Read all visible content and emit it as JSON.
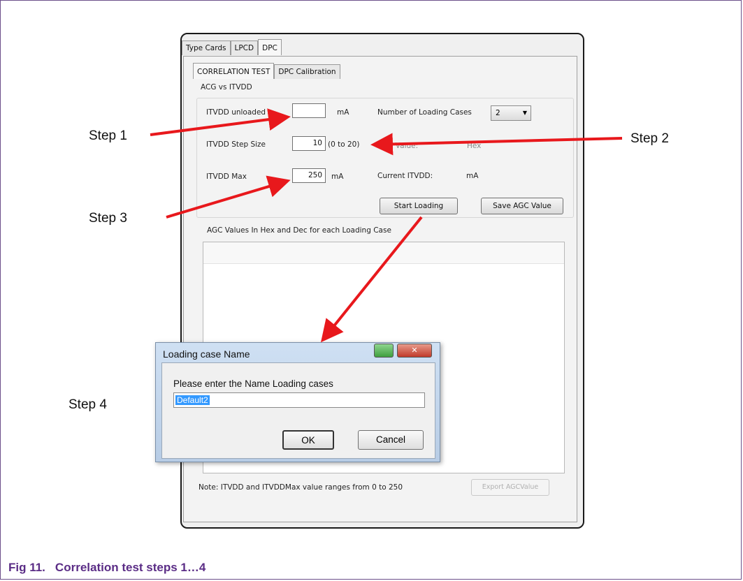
{
  "tabs_top": [
    "Type Cards",
    "LPCD",
    "DPC"
  ],
  "tabs_sub": [
    "CORRELATION TEST",
    "DPC Calibration"
  ],
  "group_title": "ACG vs ITVDD",
  "fields": {
    "itvdd_unloaded_label": "ITVDD unloaded",
    "itvdd_unloaded_value": "",
    "itvdd_unloaded_unit": "mA",
    "step_size_label": "ITVDD Step Size",
    "step_size_value": "10",
    "step_size_range": "(0 to 20)",
    "max_label": "ITVDD Max",
    "max_value": "250",
    "max_unit": "mA",
    "num_cases_label": "Number of Loading Cases",
    "num_cases_value": "2",
    "agc_value_label": "AGC Value:",
    "agc_value_unit": "Hex",
    "current_itvdd_label": "Current ITVDD:",
    "current_itvdd_unit": "mA"
  },
  "buttons": {
    "start_loading": "Start Loading",
    "save_agc": "Save AGC Value",
    "export_agc": "Export AGCValue"
  },
  "list_title": "AGC Values In Hex and Dec for each Loading Case",
  "note": "Note: ITVDD and ITVDDMax value ranges from 0 to 250",
  "dialog": {
    "title": "Loading case Name",
    "prompt": "Please enter the Name Loading cases",
    "input_value": "Default2",
    "ok": "OK",
    "cancel": "Cancel"
  },
  "steps": [
    "Step 1",
    "Step 2",
    "Step 3",
    "Step 4"
  ],
  "caption": {
    "number": "Fig 11.",
    "text": "Correlation test steps 1…4"
  },
  "colors": {
    "arrow": "#e8181c",
    "caption": "#5b2d86",
    "selection": "#3399ff"
  }
}
